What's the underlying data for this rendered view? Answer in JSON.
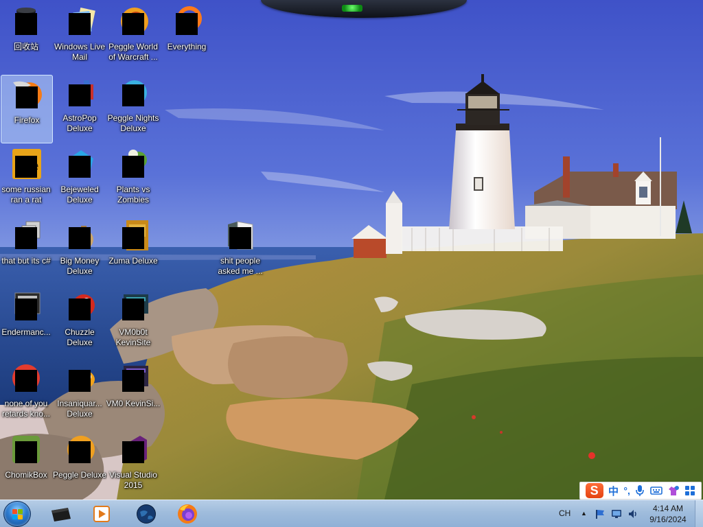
{
  "desktop": {
    "icons": [
      {
        "id": "recycle-bin",
        "label": "回收站",
        "selected": false
      },
      {
        "id": "windows-live-mail",
        "label": "Windows Live Mail",
        "selected": false
      },
      {
        "id": "peggle-world-of-warcraft",
        "label": "Peggle World of Warcraft ...",
        "selected": false
      },
      {
        "id": "everything",
        "label": "Everything",
        "selected": false
      },
      {
        "id": "firefox",
        "label": "Firefox",
        "selected": true
      },
      {
        "id": "astropop-deluxe",
        "label": "AstroPop Deluxe",
        "selected": false
      },
      {
        "id": "peggle-nights-deluxe",
        "label": "Peggle Nights Deluxe",
        "selected": false
      },
      {
        "id": "some-russian-ran-a-rat",
        "label": "some russian ran a rat",
        "selected": false
      },
      {
        "id": "bejeweled-deluxe",
        "label": "Bejeweled Deluxe",
        "selected": false
      },
      {
        "id": "plants-vs-zombies",
        "label": "Plants vs Zombies",
        "selected": false
      },
      {
        "id": "that-but-its-csharp",
        "label": "that but its c#",
        "selected": false
      },
      {
        "id": "big-money-deluxe",
        "label": "Big Money Deluxe",
        "selected": false
      },
      {
        "id": "zuma-deluxe",
        "label": "Zuma Deluxe",
        "selected": false
      },
      {
        "id": "shit-people-asked-me",
        "label": "shit people asked me ...",
        "selected": false
      },
      {
        "id": "enderman",
        "label": "Endermanc...",
        "selected": false
      },
      {
        "id": "chuzzle-deluxe",
        "label": "Chuzzle Deluxe",
        "selected": false
      },
      {
        "id": "vm0b0t-kevinsite",
        "label": "VM0b0t KevinSite",
        "selected": false
      },
      {
        "id": "none-of-you-retards",
        "label": "none of you retards kno...",
        "selected": false
      },
      {
        "id": "insaniquarium-deluxe",
        "label": "Insaniquar... Deluxe",
        "selected": false
      },
      {
        "id": "vm0-kevinsi",
        "label": "VM0 KevinSi...",
        "selected": false
      },
      {
        "id": "chomikbox",
        "label": "ChomikBox",
        "selected": false
      },
      {
        "id": "peggle-deluxe",
        "label": "Peggle Deluxe",
        "selected": false
      },
      {
        "id": "visual-studio-2015",
        "label": "Visual Studio 2015",
        "selected": false
      }
    ]
  },
  "ime_bar": {
    "logo": "S",
    "mode": "中",
    "punct": "°,",
    "icons": [
      "microphone-icon",
      "keyboard-icon",
      "skin-icon",
      "toolbox-icon"
    ]
  },
  "taskbar": {
    "pinned": [
      "explorer-icon",
      "media-player-icon",
      "globe-icon",
      "firefox-icon"
    ],
    "language": "CH",
    "tray_arrow": "▲",
    "tray_icons": [
      "flag-icon",
      "monitor-icon",
      "volume-icon"
    ],
    "clock": {
      "time": "4:14 AM",
      "date": "9/16/2024"
    }
  }
}
